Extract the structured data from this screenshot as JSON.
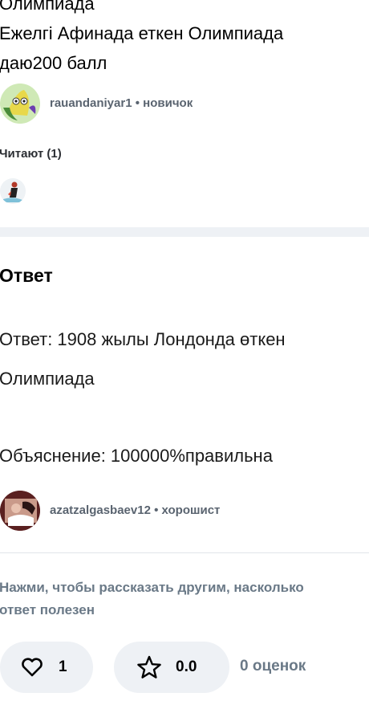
{
  "question": {
    "lines": [
      "Олимпиада",
      "Ежелгі Афинада еткен Олимпиада",
      "даю200 балл"
    ]
  },
  "asker": {
    "username": "rauandaniyar1",
    "separator": "•",
    "rank": "новичок"
  },
  "readers": {
    "label": "Читают (1)"
  },
  "answer": {
    "heading": "Ответ",
    "line1": "Ответ: 1908 жылы Лондонда өткен",
    "line2": "Олимпиада",
    "explanation": "Объяснение: 100000%правильна"
  },
  "answerer": {
    "username": "azatzalgasbaev12",
    "separator": "•",
    "rank": "хорошист"
  },
  "cta": {
    "line1": "Нажми, чтобы рассказать другим, насколько",
    "line2": "ответ полезен"
  },
  "actions": {
    "likes_count": "1",
    "rating_value": "0.0",
    "ratings_label": "0 оценок"
  },
  "colors": {
    "muted_text": "#6a7987",
    "pill_background": "#eef1f5",
    "divider": "#eef1f5"
  }
}
